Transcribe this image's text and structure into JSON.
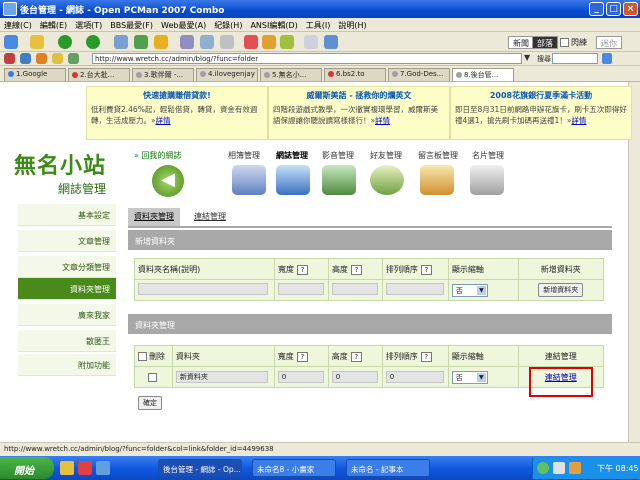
{
  "window": {
    "title": "後台管理 - 網誌 - Open PCMan 2007 Combo"
  },
  "menu": [
    "連線(C)",
    "編輯(E)",
    "選項(T)",
    "BBS最愛(F)",
    "Web最愛(A)",
    "紀錄(H)",
    "ANSI編輯(D)",
    "工具(I)",
    "說明(H)"
  ],
  "toolbar": {
    "toggles": [
      "新聞",
      "部落",
      "閃練",
      "迷你"
    ],
    "search_label": "搜尋"
  },
  "address": {
    "url": "http://www.wretch.cc/admin/blog/?func=folder"
  },
  "tabs": [
    "1.Google",
    "2.台大批...",
    "3.歌伴爾 -...",
    "4.ilovegenjay",
    "5.無名小...",
    "6.bs2.to",
    "7.God-Des...",
    "8.後台管..."
  ],
  "ads": [
    {
      "title": "快速搶購賺借貸款!",
      "body": "低利費貸2.46%起，輕鬆借貸，轉貸，資金有效週轉，生活成壓力。",
      "more": "詳情"
    },
    {
      "title": "威爾斯美語 - 拯救你的爛英文",
      "body": "四階段遊戲式教學，一次徹實複環學習，威爾斯美語保證讓你聽說讀寫樣樣行！",
      "more": "詳情"
    },
    {
      "title": "2008花旗銀行夏季滿卡活動",
      "body": "即日至8月31日前網路申辦花旗卡，刷卡五次即得好禮4選1，搶先刷卡加碼再送禮1！",
      "more": "詳情"
    }
  ],
  "logo": {
    "line1": "無名小站",
    "line2": "網誌管理"
  },
  "back_link": "» 回我的網誌",
  "nav": [
    "相簿管理",
    "網誌管理",
    "影音管理",
    "好友管理",
    "留言板管理",
    "名片管理"
  ],
  "sidebar": [
    "基本設定",
    "文章管理",
    "文章分類管理",
    "資料夾管理",
    "廣來我家",
    "散匿王",
    "附加功能"
  ],
  "subtabs": [
    "資料夾管理",
    "連結管理"
  ],
  "new_folder": {
    "section": "新增資料夾",
    "headers": [
      "資料夾名稱(說明)",
      "寬度",
      "高度",
      "排列順序",
      "顯示縮軸",
      "新增資料夾"
    ],
    "select_value": "否",
    "button": "新增資料夾"
  },
  "folders": {
    "section": "資料夾管理",
    "headers": [
      "刪除",
      "資料夾",
      "寬度",
      "高度",
      "排列順序",
      "顯示縮軸",
      "連結管理"
    ],
    "row": {
      "name": "新資料夾",
      "width": "0",
      "height": "0",
      "order": "0",
      "thumb": "否",
      "link": "連結管理"
    },
    "confirm": "確定"
  },
  "status": "http://www.wretch.cc/admin/blog/?func=folder&col=link&folder_id=4499638",
  "taskbar": {
    "start": "開始",
    "tasks": [
      "後台管理 - 網誌 - Op...",
      "未命名8 - 小畫家",
      "未命名 - 記事本"
    ],
    "clock": "下午 08:45"
  }
}
